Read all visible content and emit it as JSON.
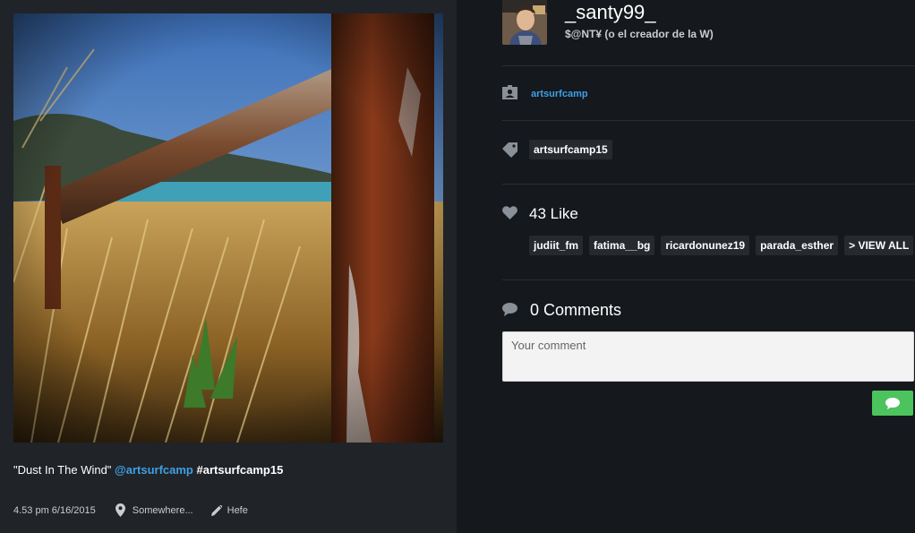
{
  "post": {
    "caption_title": "\"Dust In The Wind\"",
    "caption_mention": "@artsurfcamp",
    "caption_hashtag": "#artsurfcamp15",
    "timestamp": "4.53 pm 6/16/2015",
    "location": "Somewhere...",
    "filter": "Hefe"
  },
  "user": {
    "username": "_santy99_",
    "full_name": "$@NT¥ (o el creador de la W)"
  },
  "tagged_account": "artsurfcamp",
  "hashtags": [
    "artsurfcamp15"
  ],
  "likes": {
    "count_label": "43 Like",
    "users": [
      "judiit_fm",
      "fatima__bg",
      "ricardonunez19",
      "parada_esther"
    ],
    "view_all": "> VIEW ALL"
  },
  "comments": {
    "count_label": "0 Comments",
    "placeholder": "Your comment"
  },
  "icons": {
    "location": "map-pin-icon",
    "filter": "pencil-icon",
    "account": "contact-card-icon",
    "tag": "tag-icon",
    "likes": "heart-icon",
    "comments": "speech-bubble-icon",
    "send": "chat-bubble-icon"
  },
  "colors": {
    "link_blue": "#3f9fe6",
    "send_green": "#4cc35d",
    "panel_dark": "#15181c",
    "panel_left": "#202327",
    "chip_bg": "#262a2f"
  }
}
